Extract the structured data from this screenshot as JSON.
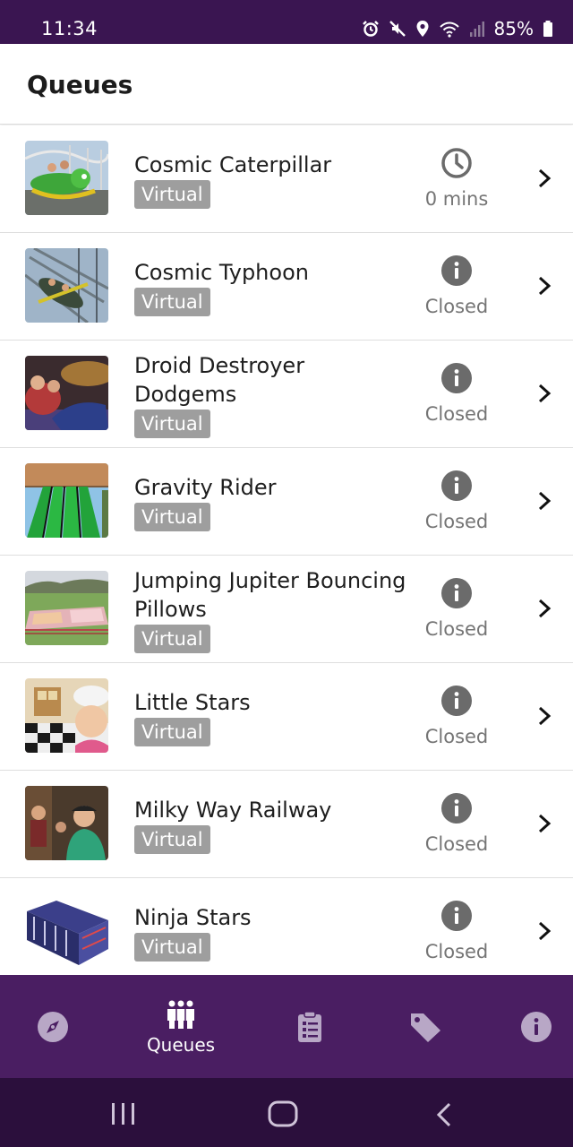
{
  "status_bar": {
    "time": "11:34",
    "battery": "85%"
  },
  "header": {
    "title": "Queues"
  },
  "queues": [
    {
      "name": "Cosmic Caterpillar",
      "tag": "Virtual",
      "status": "0 mins",
      "status_icon": "clock-icon"
    },
    {
      "name": "Cosmic Typhoon",
      "tag": "Virtual",
      "status": "Closed",
      "status_icon": "info-icon"
    },
    {
      "name": "Droid Destroyer Dodgems",
      "tag": "Virtual",
      "status": "Closed",
      "status_icon": "info-icon"
    },
    {
      "name": "Gravity Rider",
      "tag": "Virtual",
      "status": "Closed",
      "status_icon": "info-icon"
    },
    {
      "name": "Jumping Jupiter Bouncing Pillows",
      "tag": "Virtual",
      "status": "Closed",
      "status_icon": "info-icon"
    },
    {
      "name": "Little Stars",
      "tag": "Virtual",
      "status": "Closed",
      "status_icon": "info-icon"
    },
    {
      "name": "Milky Way Railway",
      "tag": "Virtual",
      "status": "Closed",
      "status_icon": "info-icon"
    },
    {
      "name": "Ninja Stars",
      "tag": "Virtual",
      "status": "Closed",
      "status_icon": "info-icon"
    }
  ],
  "bottom_nav": {
    "items": [
      {
        "icon": "compass-icon",
        "label": ""
      },
      {
        "icon": "people-queue-icon",
        "label": "Queues",
        "active": true
      },
      {
        "icon": "clipboard-list-icon",
        "label": ""
      },
      {
        "icon": "tag-icon",
        "label": ""
      },
      {
        "icon": "info-icon",
        "label": ""
      }
    ]
  },
  "colors": {
    "status_bar": "#3a1551",
    "bottom_nav": "#4a1e62",
    "system_nav": "#2b0f3c",
    "tag_background": "#9e9e9e",
    "status_icon": "#6b6b6b"
  }
}
